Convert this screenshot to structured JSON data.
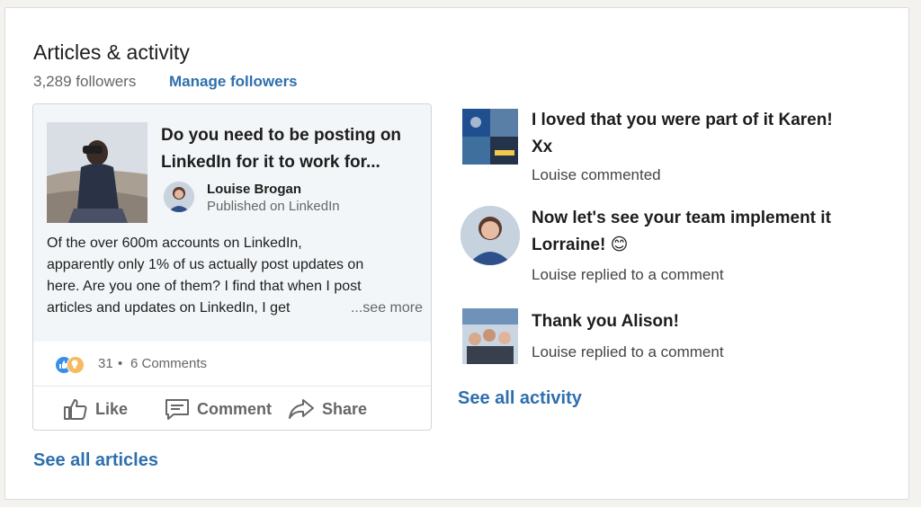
{
  "section": {
    "title": "Articles & activity",
    "followers": "3,289 followers",
    "manage_followers": "Manage followers"
  },
  "article": {
    "title": "Do you need to be posting on LinkedIn for it to work for...",
    "title_line1": "Do you need to be posting on",
    "title_line2": "LinkedIn for it to work for...",
    "author": "Louise Brogan",
    "published": "Published on LinkedIn",
    "snippet_lines": [
      "Of the over 600m accounts on LinkedIn,",
      "apparently only 1% of us actually post updates on",
      "here.  Are you one of them? I find that when I post",
      "articles and updates on LinkedIn, I get"
    ],
    "see_more": "...see more",
    "reaction_count": "31",
    "separator": "•",
    "comments": "6 Comments",
    "actions": {
      "like": "Like",
      "comment": "Comment",
      "share": "Share"
    },
    "reaction_icons": [
      "like-icon",
      "idea-icon"
    ]
  },
  "see_all_articles": "See all articles",
  "activity": {
    "items": [
      {
        "text_line1": "I loved that you were part of it Karen!",
        "text_line2": "Xx",
        "sub": "Louise commented"
      },
      {
        "text_line1": "Now let's see your team implement it",
        "text_line2": "Lorraine! 😊",
        "sub": "Louise replied to a comment"
      },
      {
        "text_line1": "Thank you Alison!",
        "sub": "Louise replied to a comment"
      }
    ],
    "see_all": "See all activity"
  },
  "colors": {
    "link": "#2e6fad",
    "muted": "#666666",
    "like_blue": "#378fe9",
    "idea_yellow": "#f5bb5c"
  }
}
